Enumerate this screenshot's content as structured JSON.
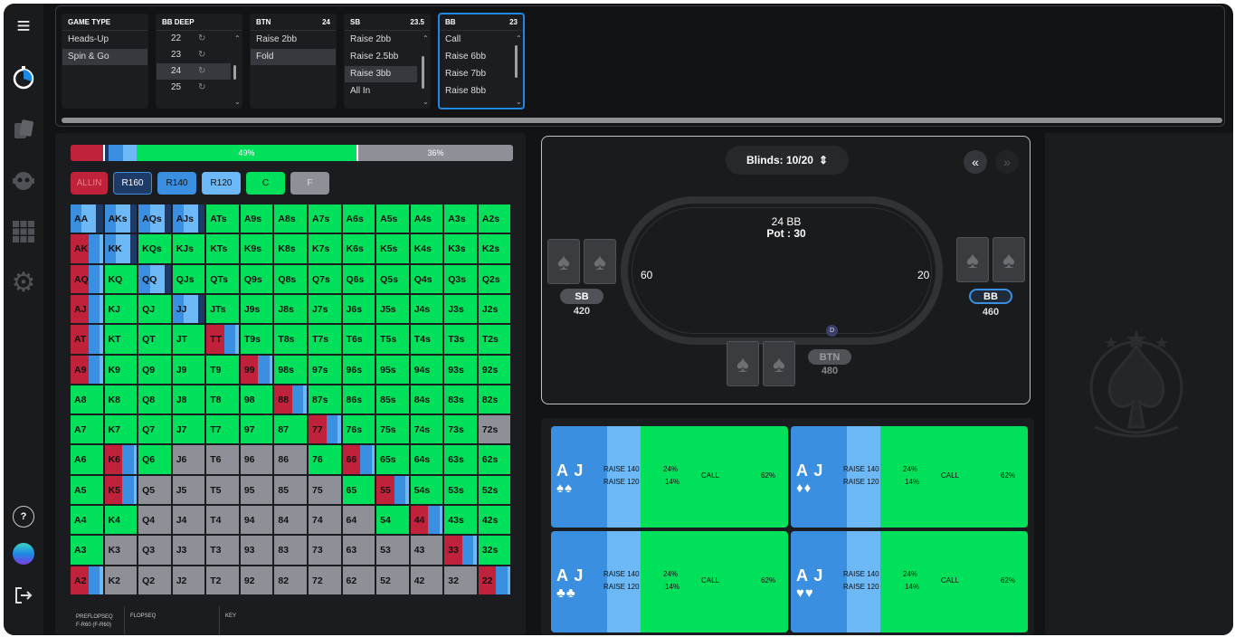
{
  "nav": {
    "icons": [
      "menu-icon",
      "timer-icon",
      "cards-icon",
      "robot-icon",
      "grid-icon",
      "gear-icon",
      "help-icon",
      "avatar",
      "logout-icon"
    ],
    "help": "?"
  },
  "columns": {
    "game_type": {
      "title": "GAME TYPE",
      "items": [
        "Heads-Up",
        "Spin & Go"
      ],
      "selected": 1
    },
    "bb_deep": {
      "title": "BB DEEP",
      "items": [
        "22",
        "23",
        "24",
        "25"
      ],
      "selected": 2
    },
    "btn": {
      "title": "BTN",
      "value": "24",
      "items": [
        "Raise 2bb",
        "Fold"
      ],
      "selected": 1
    },
    "sb": {
      "title": "SB",
      "value": "23.5",
      "items": [
        "Raise 2bb",
        "Raise 2.5bb",
        "Raise 3bb",
        "All In"
      ],
      "selected": 2
    },
    "bb": {
      "title": "BB",
      "value": "23",
      "items": [
        "Call",
        "Raise 6bb",
        "Raise 7bb",
        "Raise 8bb"
      ]
    }
  },
  "freqbar": {
    "green_pct": "49%",
    "grey_pct": "36%"
  },
  "legend": [
    {
      "label": "ALLIN",
      "bg": "#c0223b",
      "fg": "#e88"
    },
    {
      "label": "R160",
      "bg": "#1e3a66",
      "fg": "#fff"
    },
    {
      "label": "R140",
      "bg": "#3a8fe0",
      "fg": "#111"
    },
    {
      "label": "R120",
      "bg": "#6db8f6",
      "fg": "#111"
    },
    {
      "label": "C",
      "bg": "#00e05a",
      "fg": "#111"
    },
    {
      "label": "F",
      "bg": "#8e9098",
      "fg": "#ddd"
    }
  ],
  "colors": {
    "allin": "#c0223b",
    "r160": "#1e3a66",
    "r140": "#3a8fe0",
    "r120": "#6db8f6",
    "call": "#00e05a",
    "fold": "#8e9098"
  },
  "grid_labels": [
    [
      "AA",
      "AKs",
      "AQs",
      "AJs",
      "ATs",
      "A9s",
      "A8s",
      "A7s",
      "A6s",
      "A5s",
      "A4s",
      "A3s",
      "A2s"
    ],
    [
      "AK",
      "KK",
      "KQs",
      "KJs",
      "KTs",
      "K9s",
      "K8s",
      "K7s",
      "K6s",
      "K5s",
      "K4s",
      "K3s",
      "K2s"
    ],
    [
      "AQ",
      "KQ",
      "QQ",
      "QJs",
      "QTs",
      "Q9s",
      "Q8s",
      "Q7s",
      "Q6s",
      "Q5s",
      "Q4s",
      "Q3s",
      "Q2s"
    ],
    [
      "AJ",
      "KJ",
      "QJ",
      "JJ",
      "JTs",
      "J9s",
      "J8s",
      "J7s",
      "J6s",
      "J5s",
      "J4s",
      "J3s",
      "J2s"
    ],
    [
      "AT",
      "KT",
      "QT",
      "JT",
      "TT",
      "T9s",
      "T8s",
      "T7s",
      "T6s",
      "T5s",
      "T4s",
      "T3s",
      "T2s"
    ],
    [
      "A9",
      "K9",
      "Q9",
      "J9",
      "T9",
      "99",
      "98s",
      "97s",
      "96s",
      "95s",
      "94s",
      "93s",
      "92s"
    ],
    [
      "A8",
      "K8",
      "Q8",
      "J8",
      "T8",
      "98",
      "88",
      "87s",
      "86s",
      "85s",
      "84s",
      "83s",
      "82s"
    ],
    [
      "A7",
      "K7",
      "Q7",
      "J7",
      "T7",
      "97",
      "87",
      "77",
      "76s",
      "75s",
      "74s",
      "73s",
      "72s"
    ],
    [
      "A6",
      "K6",
      "Q6",
      "J6",
      "T6",
      "96",
      "86",
      "76",
      "66",
      "65s",
      "64s",
      "63s",
      "62s"
    ],
    [
      "A5",
      "K5",
      "Q5",
      "J5",
      "T5",
      "95",
      "85",
      "75",
      "65",
      "55",
      "54s",
      "53s",
      "52s"
    ],
    [
      "A4",
      "K4",
      "Q4",
      "J4",
      "T4",
      "94",
      "84",
      "74",
      "64",
      "54",
      "44",
      "43s",
      "42s"
    ],
    [
      "A3",
      "K3",
      "Q3",
      "J3",
      "T3",
      "93",
      "83",
      "73",
      "63",
      "53",
      "43",
      "33",
      "32s"
    ],
    [
      "A2",
      "K2",
      "Q2",
      "J2",
      "T2",
      "92",
      "82",
      "72",
      "62",
      "52",
      "42",
      "32",
      "22"
    ]
  ],
  "grid_mix": [
    [
      "b",
      "b",
      "b",
      "b",
      "c",
      "c",
      "c",
      "c",
      "c",
      "c",
      "c",
      "c",
      "c"
    ],
    [
      "a",
      "b",
      "c",
      "c",
      "c",
      "c",
      "c",
      "c",
      "c",
      "c",
      "c",
      "c",
      "c"
    ],
    [
      "a",
      "c",
      "b",
      "c",
      "c",
      "c",
      "c",
      "c",
      "c",
      "c",
      "c",
      "c",
      "c"
    ],
    [
      "a",
      "c",
      "c",
      "b",
      "c",
      "c",
      "c",
      "c",
      "c",
      "c",
      "c",
      "c",
      "c"
    ],
    [
      "a",
      "c",
      "c",
      "c",
      "a",
      "c",
      "c",
      "c",
      "c",
      "c",
      "c",
      "c",
      "c"
    ],
    [
      "a",
      "c",
      "c",
      "c",
      "c",
      "a",
      "c",
      "c",
      "c",
      "c",
      "c",
      "c",
      "c"
    ],
    [
      "c",
      "c",
      "c",
      "c",
      "c",
      "c",
      "a",
      "c",
      "c",
      "c",
      "c",
      "c",
      "c"
    ],
    [
      "c",
      "c",
      "c",
      "c",
      "c",
      "c",
      "c",
      "a",
      "c",
      "c",
      "c",
      "c",
      "f"
    ],
    [
      "c",
      "a",
      "c",
      "f",
      "f",
      "f",
      "f",
      "c",
      "a",
      "c",
      "c",
      "c",
      "c"
    ],
    [
      "c",
      "a",
      "f",
      "f",
      "f",
      "f",
      "f",
      "f",
      "c",
      "a",
      "c",
      "c",
      "c"
    ],
    [
      "c",
      "c",
      "f",
      "f",
      "f",
      "f",
      "f",
      "f",
      "f",
      "c",
      "a",
      "c",
      "c"
    ],
    [
      "c",
      "f",
      "f",
      "f",
      "f",
      "f",
      "f",
      "f",
      "f",
      "f",
      "f",
      "a",
      "c"
    ],
    [
      "a",
      "f",
      "f",
      "f",
      "f",
      "f",
      "f",
      "f",
      "f",
      "f",
      "f",
      "f",
      "a"
    ]
  ],
  "seq": {
    "preflop_label": "PREFLOPSEQ",
    "preflop_value": "F-R60 (F-R60)",
    "flop_label": "FLOPSEQ",
    "key_label": "KEY"
  },
  "table": {
    "blinds": "Blinds: 10/20",
    "blinds_arrows": "⇕",
    "prev": "«",
    "next": "»",
    "bb_deep": "24 BB",
    "pot": "Pot : 30",
    "sb_bet": "60",
    "bb_bet": "20",
    "dealer": "D",
    "players": {
      "sb": {
        "name": "SB",
        "stack": "420"
      },
      "bb": {
        "name": "BB",
        "stack": "460"
      },
      "btn": {
        "name": "BTN",
        "stack": "480"
      }
    }
  },
  "combos": [
    {
      "cards": "A J",
      "suits": "♠♠",
      "r140_label": "RAISE 140",
      "r140": "24%",
      "r120_label": "RAISE 120",
      "r120": "14%",
      "call_label": "CALL",
      "call": "62%"
    },
    {
      "cards": "A J",
      "suits": "♦♦",
      "r140_label": "RAISE 140",
      "r140": "24%",
      "r120_label": "RAISE 120",
      "r120": "14%",
      "call_label": "CALL",
      "call": "62%"
    },
    {
      "cards": "A J",
      "suits": "♣♣",
      "r140_label": "RAISE 140",
      "r140": "24%",
      "r120_label": "RAISE 120",
      "r120": "14%",
      "call_label": "CALL",
      "call": "62%"
    },
    {
      "cards": "A J",
      "suits": "♥♥",
      "r140_label": "RAISE 140",
      "r140": "24%",
      "r120_label": "RAISE 120",
      "r120": "14%",
      "call_label": "CALL",
      "call": "62%"
    }
  ]
}
